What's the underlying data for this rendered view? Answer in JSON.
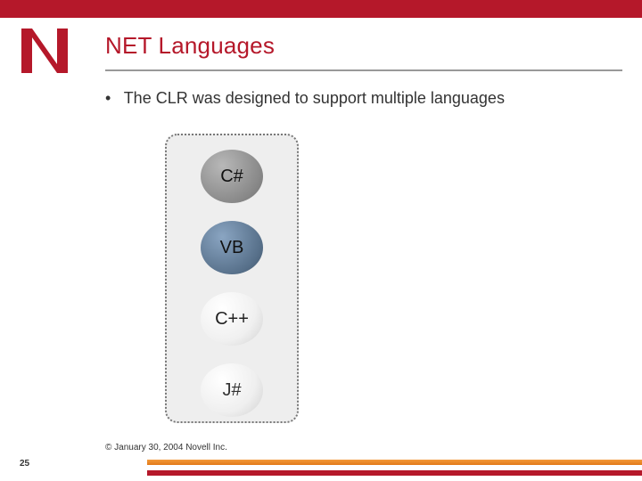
{
  "brand": {
    "logo_letter": "N",
    "color": "#b5182a"
  },
  "slide": {
    "title": "NET Languages",
    "bullets": [
      "The CLR was designed to support multiple languages"
    ],
    "languages": [
      {
        "key": "csharp",
        "label": "C#"
      },
      {
        "key": "vb",
        "label": "VB"
      },
      {
        "key": "cpp",
        "label": "C++"
      },
      {
        "key": "jsharp",
        "label": "J#"
      }
    ]
  },
  "footer": {
    "page_number": "25",
    "copyright": "© January 30, 2004 Novell Inc."
  }
}
